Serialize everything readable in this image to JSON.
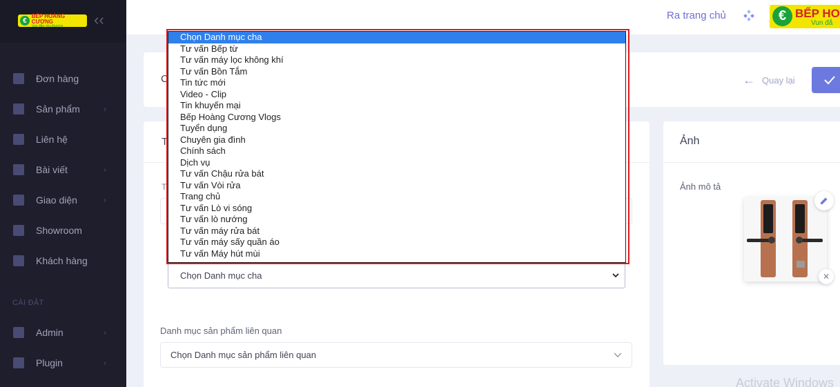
{
  "sidebar": {
    "logo_line1": "BẾP HOÀNG CƯƠNG",
    "logo_line2": "Vun đắp yêu thương",
    "collapse_icon": "chevrons-left-icon",
    "items": [
      {
        "label": "Đơn hàng",
        "icon": "clipboard-icon",
        "has_children": false
      },
      {
        "label": "Sản phẩm",
        "icon": "box-icon",
        "has_children": true
      },
      {
        "label": "Liên hệ",
        "icon": "contact-icon",
        "has_children": false
      },
      {
        "label": "Bài viết",
        "icon": "document-icon",
        "has_children": true
      },
      {
        "label": "Giao diện",
        "icon": "monitor-icon",
        "has_children": true
      },
      {
        "label": "Showroom",
        "icon": "user-icon",
        "has_children": false
      },
      {
        "label": "Khách hàng",
        "icon": "users-icon",
        "has_children": false
      }
    ],
    "section_label": "CÀI ĐẶT",
    "settings_items": [
      {
        "label": "Admin",
        "icon": "admin-icon",
        "has_children": true
      },
      {
        "label": "Plugin",
        "icon": "plugin-icon",
        "has_children": true
      }
    ]
  },
  "header": {
    "home_link": "Ra trang chủ",
    "logo_line1": "BẾP HOÀ",
    "logo_line2": "Vun đắ"
  },
  "subheader": {
    "title_stub": "C",
    "back_label": "Quay lại"
  },
  "form": {
    "card_title_stub": "T",
    "label_stub": "T",
    "parent_select_value": "Chọn Danh mục cha",
    "related_label": "Danh mục sản phẩm liên quan",
    "related_placeholder": "Chọn Danh mục sản phẩm liên quan"
  },
  "image_card": {
    "title": "Ảnh",
    "label": "Ảnh mô tả"
  },
  "dropdown": {
    "selected_index": 0,
    "options": [
      "Chọn Danh mục cha",
      "Tư vấn Bếp từ",
      "Tư vấn máy lọc không khí",
      "Tư vấn Bồn Tắm",
      "Tin tức mới",
      "Video - Clip",
      "Tin khuyến mại",
      "Bếp Hoàng Cương Vlogs",
      "Tuyển dụng",
      "Chuyên gia đình",
      "Chính sách",
      "Dịch vụ",
      "Tư vấn Chậu rửa bát",
      "Tư vấn Vòi rửa",
      "Trang chủ",
      "Tư vấn Lò vi sóng",
      "Tư vấn lò nướng",
      "Tư vấn máy rửa bát",
      "Tư vấn máy sấy quần áo",
      "Tư vấn Máy hút mùi"
    ]
  },
  "watermark": "Activate Windows",
  "colors": {
    "sidebar_bg": "#1e1e2d",
    "accent": "#6c7ae0",
    "highlight": "#2f80ed",
    "annotation_border": "#e0151d"
  }
}
